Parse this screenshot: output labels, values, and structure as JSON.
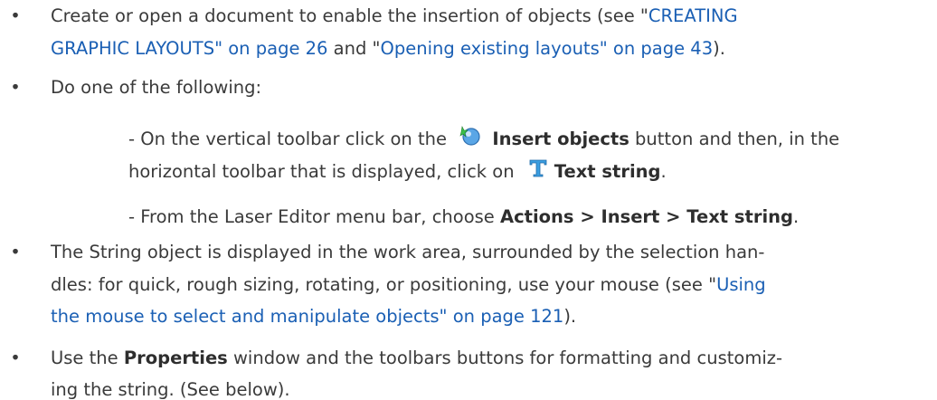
{
  "bullets": [
    {
      "lines": [
        [
          {
            "t": "Create or open a document to enable the insertion of objects (see \""
          },
          {
            "t": "CREATING",
            "link": true
          }
        ],
        [
          {
            "t": "GRAPHIC LAYOUTS\" on page 26",
            "link": true
          },
          {
            "t": " and \""
          },
          {
            "t": "Opening existing layouts\" on page 43",
            "link": true
          },
          {
            "t": ")."
          }
        ]
      ]
    },
    {
      "lines": [
        [
          {
            "t": "Do one of the following:"
          }
        ]
      ]
    },
    {
      "lines": [
        [
          {
            "t": "The String object is displayed in the work area, surrounded by the selection han-"
          }
        ],
        [
          {
            "t": "dles: for quick, rough sizing, rotating, or positioning, use your mouse (see \""
          },
          {
            "t": "Using",
            "link": true
          }
        ],
        [
          {
            "t": "the mouse to select and manipulate objects\" on page 121",
            "link": true
          },
          {
            "t": ")."
          }
        ]
      ]
    },
    {
      "lines": [
        [
          {
            "t": "Use the "
          },
          {
            "t": "Properties",
            "bold": true
          },
          {
            "t": " window and the toolbars buttons for formatting and customiz-"
          }
        ],
        [
          {
            "t": "ing the string. (See below)."
          }
        ]
      ]
    }
  ],
  "sub": {
    "a1_pre": "- On the vertical toolbar click on the",
    "a1_bold": "Insert objects",
    "a1_post": "button and then, in the",
    "a2_pre": "horizontal toolbar that is displayed, click on",
    "a2_bold": "Text string",
    "a2_post": ".",
    "b_pre": "- From the Laser Editor menu bar, choose",
    "b_bold": "Actions > Insert > Text string",
    "b_post": "."
  },
  "bullet_char": "•",
  "colors": {
    "text": "#3a3a3a",
    "link": "#1a5fb4"
  },
  "icons": [
    "insert-objects-icon",
    "text-string-icon"
  ]
}
